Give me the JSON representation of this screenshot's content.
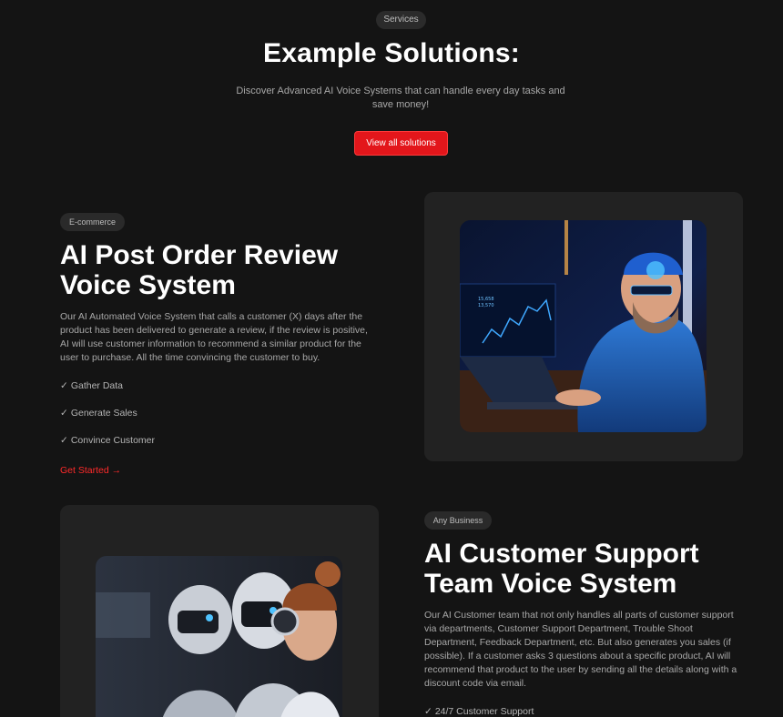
{
  "header": {
    "pill": "Services",
    "title": "Example Solutions:",
    "subtitle_line1": "Discover Advanced AI Voice Systems that can handle every day tasks and",
    "subtitle_line2": "save money!",
    "button_label": "View all solutions"
  },
  "solution1": {
    "tag": "E-commerce",
    "title_line1": "AI Post Order Review",
    "title_line2": "Voice System",
    "description": "Our AI Automated Voice System that calls a customer (X) days after the product has been delivered to generate a review, if the review is positive, AI will use customer information to recommend a similar product for the user to purchase. All the time convincing the customer to buy.",
    "features": [
      "Gather Data",
      "Generate Sales",
      "Convince Customer"
    ],
    "cta": "Get Started",
    "image_alt": "Man with AI headset working on laptop with charts"
  },
  "solution2": {
    "tag": "Any Business",
    "title_line1": "AI Customer Support",
    "title_line2": "Team Voice System",
    "description": "Our AI Customer team that not only handles all parts of customer support via departments, Customer Support Department, Trouble Shoot Department, Feedback Department, etc. But also generates you sales (if possible). If a customer asks 3 questions about a specific product, AI will recommend that product to the user by sending all the details along with a discount code via email.",
    "features": [
      "24/7 Customer Support"
    ],
    "image_alt": "Robotic customer support agents wearing headsets"
  },
  "chart_labels": [
    "15,658",
    "13,570"
  ],
  "colors": {
    "accent": "#e3161b",
    "bg": "#141414",
    "card": "#222222"
  }
}
